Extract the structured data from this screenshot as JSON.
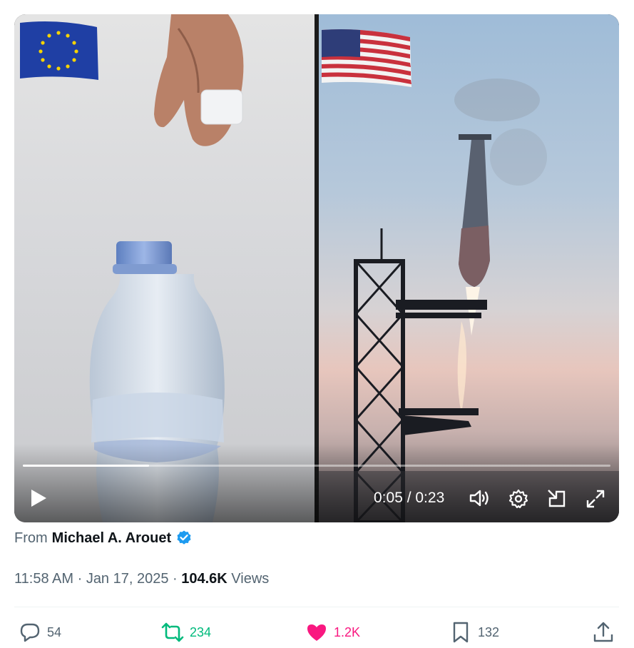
{
  "video": {
    "progress_fraction": 0.215,
    "time_label": "0:05 / 0:23",
    "play_icon": "play-icon",
    "volume_icon": "volume-icon",
    "settings_icon": "gear-icon",
    "popout_icon": "popout-icon",
    "fullscreen_icon": "fullscreen-icon"
  },
  "attribution": {
    "prefix": "From",
    "author": "Michael A. Arouet",
    "verified_icon": "verified-badge-icon"
  },
  "meta": {
    "time": "11:58 AM",
    "dot1": " · ",
    "date": "Jan 17, 2025",
    "dot2": " · ",
    "views_count": "104.6K",
    "views_label": " Views"
  },
  "actions": {
    "replies": "54",
    "reposts": "234",
    "likes": "1.2K",
    "bookmarks": "132"
  },
  "colors": {
    "text_secondary": "#536471",
    "repost_green": "#00ba7c",
    "like_pink": "#f91880",
    "verified_blue": "#1d9bf0"
  }
}
